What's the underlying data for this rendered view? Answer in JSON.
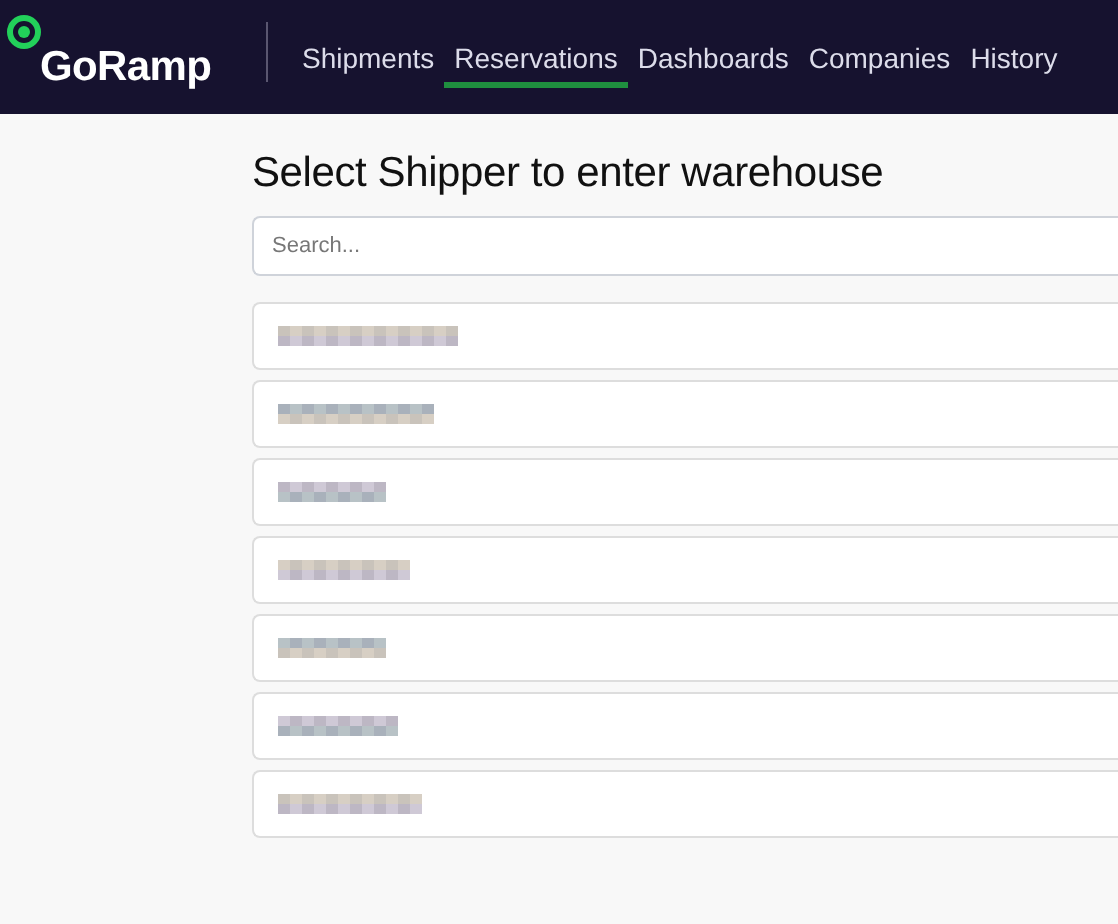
{
  "brand": {
    "name": "GoRamp"
  },
  "nav": [
    {
      "label": "Shipments",
      "selected": false
    },
    {
      "label": "Reservations",
      "selected": true
    },
    {
      "label": "Dashboards",
      "selected": false
    },
    {
      "label": "Companies",
      "selected": false
    },
    {
      "label": "History",
      "selected": false
    }
  ],
  "heading": "Select Shipper to enter warehouse",
  "search": {
    "placeholder": "Search..."
  },
  "shippers": [
    {
      "kind": "pixelated"
    },
    {
      "kind": "pixelated"
    },
    {
      "kind": "pixelated"
    },
    {
      "kind": "pixelated"
    },
    {
      "kind": "pixelated"
    },
    {
      "kind": "pixelated"
    },
    {
      "kind": "pixelated"
    }
  ]
}
